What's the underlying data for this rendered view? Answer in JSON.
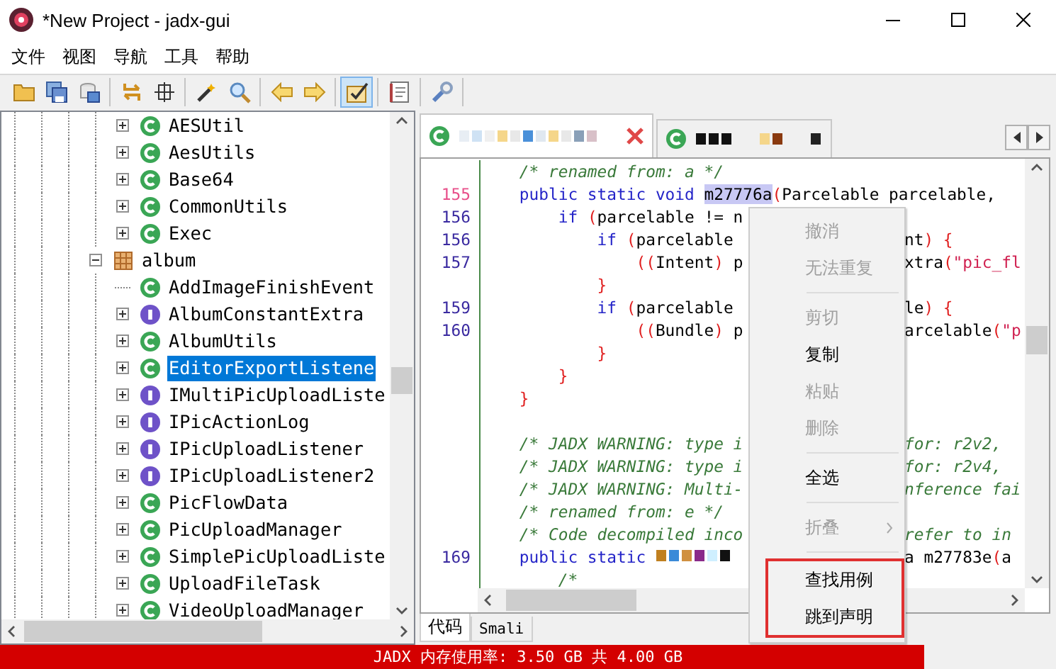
{
  "window": {
    "title": "*New Project - jadx-gui"
  },
  "menu": [
    "文件",
    "视图",
    "导航",
    "工具",
    "帮助"
  ],
  "toolbar": [
    [
      {
        "selected": false
      },
      {
        "selected": false
      },
      {
        "selected": false
      }
    ],
    [
      {
        "selected": false
      },
      {
        "selected": false
      }
    ],
    [
      {
        "selected": false
      },
      {
        "selected": false
      }
    ],
    [
      {
        "selected": false
      },
      {
        "selected": false
      }
    ],
    [
      {
        "selected": true
      }
    ],
    [
      {
        "selected": false
      }
    ],
    [
      {
        "selected": false
      }
    ]
  ],
  "tree": [
    {
      "children": [
        {
          "label": "AESUtil",
          "kind": "class",
          "leaf": false,
          "expanded": false,
          "selected": false
        },
        {
          "label": "AesUtils",
          "kind": "class",
          "leaf": false,
          "expanded": false,
          "selected": false
        },
        {
          "label": "Base64",
          "kind": "class",
          "leaf": false,
          "expanded": false,
          "selected": false
        },
        {
          "label": "CommonUtils",
          "kind": "class",
          "leaf": false,
          "expanded": false,
          "selected": false
        },
        {
          "label": "Exec",
          "kind": "class",
          "leaf": false,
          "expanded": false,
          "selected": false
        }
      ]
    },
    {
      "label": "album",
      "kind": "package",
      "leaf": false,
      "expanded": true,
      "selected": false,
      "children": [
        {
          "label": "AddImageFinishEvent",
          "kind": "class",
          "leaf": true,
          "selected": false
        },
        {
          "label": "AlbumConstantExtra",
          "kind": "interface",
          "leaf": false,
          "expanded": false,
          "selected": false
        },
        {
          "label": "AlbumUtils",
          "kind": "class",
          "leaf": false,
          "expanded": false,
          "selected": false
        },
        {
          "label": "EditorExportListene",
          "kind": "class",
          "leaf": false,
          "expanded": false,
          "selected": true
        },
        {
          "label": "IMultiPicUploadListe",
          "kind": "interface",
          "leaf": false,
          "expanded": false,
          "selected": false
        },
        {
          "label": "IPicActionLog",
          "kind": "interface",
          "leaf": false,
          "expanded": false,
          "selected": false
        },
        {
          "label": "IPicUploadListener",
          "kind": "interface",
          "leaf": false,
          "expanded": false,
          "selected": false
        },
        {
          "label": "IPicUploadListener2",
          "kind": "interface",
          "leaf": false,
          "expanded": false,
          "selected": false
        },
        {
          "label": "PicFlowData",
          "kind": "class",
          "leaf": false,
          "expanded": false,
          "selected": false
        },
        {
          "label": "PicUploadManager",
          "kind": "class",
          "leaf": false,
          "expanded": false,
          "selected": false
        },
        {
          "label": "SimplePicUploadListe",
          "kind": "class",
          "leaf": false,
          "expanded": false,
          "selected": false
        },
        {
          "label": "UploadFileTask",
          "kind": "class",
          "leaf": false,
          "expanded": false,
          "selected": false
        },
        {
          "label": "VideoUploadManager",
          "kind": "class",
          "leaf": false,
          "expanded": false,
          "selected": false
        }
      ]
    }
  ],
  "editor_tabs": [
    {
      "selected": true,
      "closable": true
    },
    {
      "selected": false,
      "closable": false
    }
  ],
  "code": [
    {
      "redacted": false,
      "left": [
        {
          "text": "    /* renamed from: a */",
          "kind": "comment"
        }
      ]
    },
    {
      "number": "155",
      "current": true,
      "redacted": false,
      "left": [
        {
          "text": "    public static void ",
          "kind": "keyword"
        },
        {
          "text": "m27776a",
          "kind": "selected"
        },
        {
          "text": "(",
          "kind": "paren"
        },
        {
          "text": "Parcelable parcelable, ",
          "kind": "plain"
        }
      ]
    },
    {
      "number": "156",
      "current": false,
      "redacted": false,
      "left": [
        {
          "text": "        if ",
          "kind": "keyword"
        },
        {
          "text": "(",
          "kind": "paren"
        },
        {
          "text": "parcelable != n",
          "kind": "plain"
        }
      ]
    },
    {
      "number": "156",
      "current": false,
      "redacted": false,
      "left": [
        {
          "text": "            if ",
          "kind": "keyword"
        },
        {
          "text": "(",
          "kind": "paren"
        },
        {
          "text": "parcelable ",
          "kind": "plain"
        }
      ],
      "right": [
        {
          "text": "nt",
          "kind": "plain"
        },
        {
          "text": ") {",
          "kind": "paren"
        }
      ]
    },
    {
      "number": "157",
      "current": false,
      "redacted": false,
      "left": [
        {
          "text": "                ((",
          "kind": "paren"
        },
        {
          "text": "Intent",
          "kind": "plain"
        },
        {
          "text": ") ",
          "kind": "paren"
        },
        {
          "text": "p",
          "kind": "plain"
        }
      ],
      "right": [
        {
          "text": "xtra",
          "kind": "plain"
        },
        {
          "text": "(",
          "kind": "paren"
        },
        {
          "text": "\"pic_fl",
          "kind": "string"
        }
      ]
    },
    {
      "redacted": false,
      "left": [
        {
          "text": "            }",
          "kind": "paren"
        }
      ]
    },
    {
      "number": "159",
      "current": false,
      "redacted": false,
      "left": [
        {
          "text": "            if ",
          "kind": "keyword"
        },
        {
          "text": "(",
          "kind": "paren"
        },
        {
          "text": "parcelable ",
          "kind": "plain"
        }
      ],
      "right": [
        {
          "text": "le",
          "kind": "plain"
        },
        {
          "text": ") {",
          "kind": "paren"
        }
      ]
    },
    {
      "number": "160",
      "current": false,
      "redacted": false,
      "left": [
        {
          "text": "                ((",
          "kind": "paren"
        },
        {
          "text": "Bundle",
          "kind": "plain"
        },
        {
          "text": ") ",
          "kind": "paren"
        },
        {
          "text": "p",
          "kind": "plain"
        }
      ],
      "right": [
        {
          "text": "arcelable",
          "kind": "plain"
        },
        {
          "text": "(",
          "kind": "paren"
        },
        {
          "text": "\"p",
          "kind": "string"
        }
      ]
    },
    {
      "redacted": false,
      "left": [
        {
          "text": "            }",
          "kind": "paren"
        }
      ]
    },
    {
      "redacted": false,
      "left": [
        {
          "text": "        }",
          "kind": "paren"
        }
      ]
    },
    {
      "redacted": false,
      "left": [
        {
          "text": "    }",
          "kind": "paren"
        }
      ]
    },
    {
      "redacted": false
    },
    {
      "redacted": false,
      "left": [
        {
          "text": "    /* JADX WARNING: type i",
          "kind": "comment"
        }
      ],
      "right": [
        {
          "text": "for: r2v2,",
          "kind": "comment"
        }
      ]
    },
    {
      "redacted": false,
      "left": [
        {
          "text": "    /* JADX WARNING: type i",
          "kind": "comment"
        }
      ],
      "right": [
        {
          "text": "for: r2v4,",
          "kind": "comment"
        }
      ]
    },
    {
      "redacted": false,
      "left": [
        {
          "text": "    /* JADX WARNING: Multi-",
          "kind": "comment"
        }
      ],
      "right": [
        {
          "text": "nference fai",
          "kind": "comment"
        }
      ]
    },
    {
      "redacted": false,
      "left": [
        {
          "text": "    /* renamed from: e */",
          "kind": "comment"
        }
      ]
    },
    {
      "redacted": false,
      "left": [
        {
          "text": "    /* Code decompiled inco",
          "kind": "comment"
        }
      ],
      "right": [
        {
          "text": "refer to in",
          "kind": "comment"
        }
      ]
    },
    {
      "number": "169",
      "current": false,
      "redacted": true,
      "left": [
        {
          "text": "    public static ",
          "kind": "keyword"
        }
      ],
      "right": [
        {
          "text": "a m27783e",
          "kind": "plain"
        },
        {
          "text": "(",
          "kind": "paren"
        },
        {
          "text": "a",
          "kind": "plain"
        }
      ]
    },
    {
      "redacted": false,
      "left": [
        {
          "text": "        /*",
          "kind": "comment"
        }
      ]
    }
  ],
  "context_menu": [
    {
      "outlined": false,
      "items": [
        {
          "label": "撤消",
          "disabled": true,
          "submenu": false
        },
        {
          "label": "无法重复",
          "disabled": true,
          "submenu": false
        }
      ]
    },
    {
      "outlined": false,
      "items": [
        {
          "label": "剪切",
          "disabled": true,
          "submenu": false
        },
        {
          "label": "复制",
          "disabled": false,
          "submenu": false
        },
        {
          "label": "粘贴",
          "disabled": true,
          "submenu": false
        },
        {
          "label": "删除",
          "disabled": true,
          "submenu": false
        }
      ]
    },
    {
      "outlined": false,
      "items": [
        {
          "label": "全选",
          "disabled": false,
          "submenu": false
        }
      ]
    },
    {
      "outlined": false,
      "items": [
        {
          "label": "折叠",
          "disabled": true,
          "submenu": true
        }
      ]
    },
    {
      "outlined": true,
      "items": [
        {
          "label": "查找用例",
          "disabled": false,
          "submenu": false
        },
        {
          "label": "跳到声明",
          "disabled": false,
          "submenu": false
        }
      ]
    }
  ],
  "bottom_tabs": [
    {
      "label": "代码",
      "selected": true
    },
    {
      "label": "Smali",
      "selected": false
    }
  ],
  "status_bar": {
    "text": "JADX 内存使用率: 3.50 GB 共 4.00 GB",
    "level": 0.875
  }
}
